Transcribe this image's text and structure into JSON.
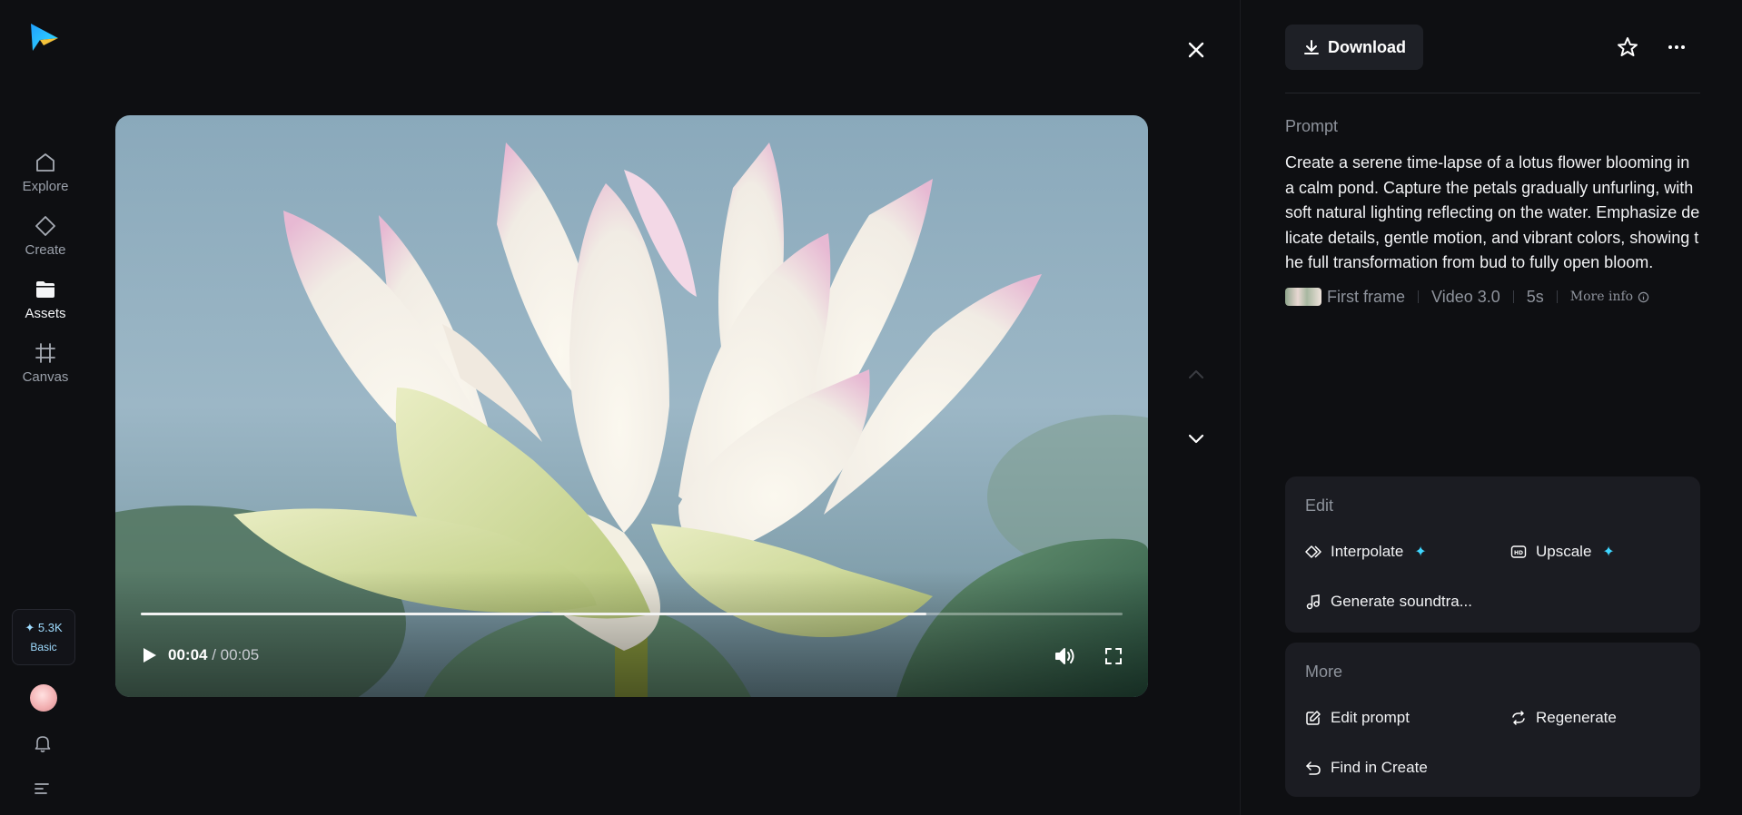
{
  "sidebar": {
    "items": [
      {
        "label": "Explore",
        "icon": "home-icon"
      },
      {
        "label": "Create",
        "icon": "diamond-icon"
      },
      {
        "label": "Assets",
        "icon": "folder-icon",
        "active": true
      },
      {
        "label": "Canvas",
        "icon": "canvas-icon"
      }
    ],
    "credits": {
      "amount": "✦ 5.3K",
      "plan": "Basic"
    }
  },
  "player": {
    "current_time": "00:04",
    "total_time": "/ 00:05",
    "progress": 0.8
  },
  "panel": {
    "download_label": "Download",
    "prompt_title": "Prompt",
    "prompt_text": "Create a serene time-lapse of a lotus flower blooming in a calm pond. Capture the petals gradually unfurling, with soft natural lighting reflecting on the water. Emphasize delicate details, gentle motion, and vibrant colors, showing the full transformation from bud to fully open bloom.",
    "meta": {
      "first_frame": "First frame",
      "model": "Video 3.0",
      "duration": "5s",
      "more_info": "More info"
    },
    "edit": {
      "title": "Edit",
      "interpolate": "Interpolate",
      "upscale": "Upscale",
      "soundtrack": "Generate soundtra..."
    },
    "more": {
      "title": "More",
      "edit_prompt": "Edit prompt",
      "regenerate": "Regenerate",
      "find_in_create": "Find in Create"
    }
  },
  "colors": {
    "background": "#0e0f12",
    "card": "#1b1c22",
    "accent": "#3fd6ff"
  }
}
